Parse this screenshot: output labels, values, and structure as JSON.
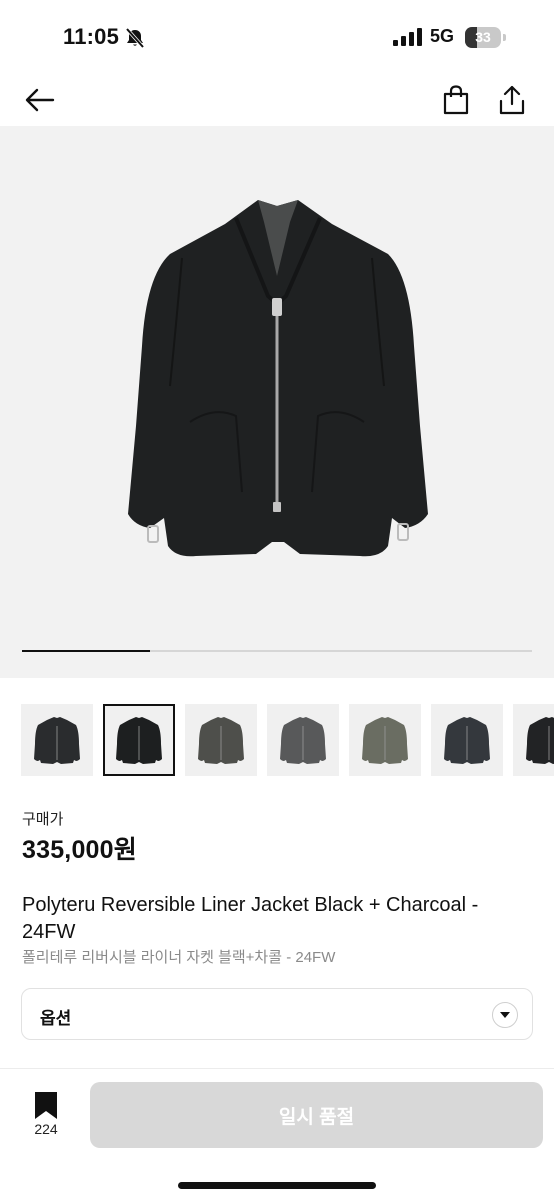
{
  "status_bar": {
    "time": "11:05",
    "network": "5G",
    "battery_level": 33,
    "battery_text": "33"
  },
  "nav": {
    "back_icon": "arrow-left-icon",
    "bag_icon": "shopping-bag-icon",
    "share_icon": "share-icon"
  },
  "gallery": {
    "slide_progress": 0.25,
    "active_thumb_index": 1,
    "thumbnails": [
      {
        "color": "#2a2c2e"
      },
      {
        "color": "#1d1f20"
      },
      {
        "color": "#4e4f4b"
      },
      {
        "color": "#58595a"
      },
      {
        "color": "#6a6d62"
      },
      {
        "color": "#34383d"
      },
      {
        "color": "#222325"
      }
    ]
  },
  "product": {
    "price_label": "구매가",
    "price": "335,000원",
    "title_en": "Polyteru Reversible Liner Jacket Black + Charcoal - 24FW",
    "title_ko": "폴리테루 리버시블 라이너 자켓 블랙+차콜 - 24FW"
  },
  "option": {
    "label": "옵션",
    "icon": "chevron-down-icon"
  },
  "bottom_bar": {
    "bookmark_count": "224",
    "buy_button_label": "일시 품절"
  },
  "colors": {
    "accent": "#111111",
    "disabled_button": "#d8d8d8",
    "hero_bg": "#f2f2f2"
  }
}
